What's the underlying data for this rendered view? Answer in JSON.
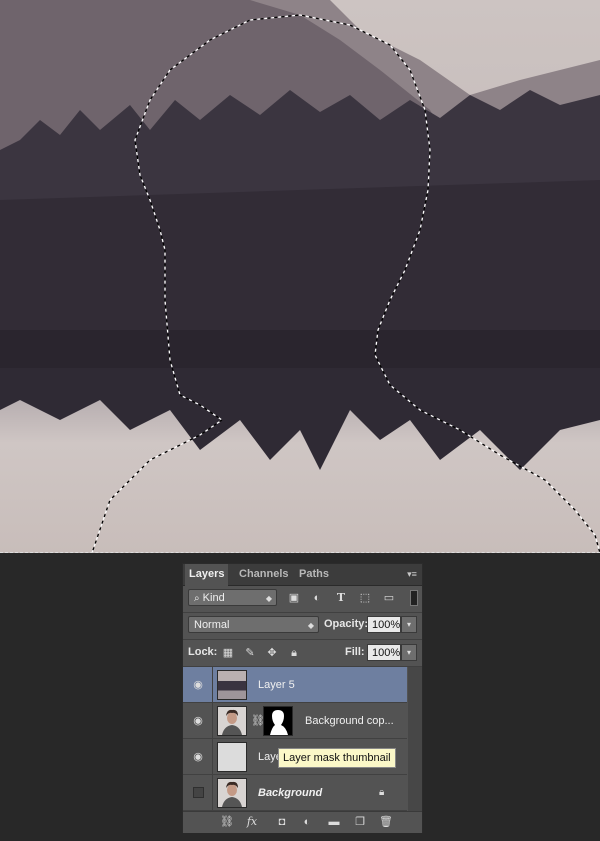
{
  "panel": {
    "tabs": [
      {
        "label": "Layers"
      },
      {
        "label": "Channels"
      },
      {
        "label": "Paths"
      }
    ],
    "filter": {
      "label": "Kind"
    },
    "blend_mode": "Normal",
    "opacity": {
      "label": "Opacity:",
      "value": "100%"
    },
    "lock": {
      "label": "Lock:"
    },
    "fill": {
      "label": "Fill:",
      "value": "100%"
    },
    "layers": [
      {
        "name": "Layer 5",
        "visible": true,
        "selected": true
      },
      {
        "name": "Background cop...",
        "visible": true,
        "selected": false
      },
      {
        "name": "Laye",
        "visible": true,
        "selected": false
      },
      {
        "name": "Background",
        "visible": false,
        "selected": false
      }
    ]
  },
  "tooltip": "Layer mask thumbnail",
  "colors": {
    "selected_layer": "#6e7fa0",
    "panel_bg": "#535353",
    "app_bg": "#282828"
  },
  "icons": [
    "search-icon",
    "image-filter-icon",
    "adjustment-filter-icon",
    "type-filter-icon",
    "shape-filter-icon",
    "smart-object-filter-icon",
    "filter-toggle-icon",
    "lock-pixels-icon",
    "lock-brush-icon",
    "lock-move-icon",
    "lock-all-icon",
    "eye-icon",
    "link-icon",
    "fx-icon",
    "mask-icon",
    "adjustment-icon",
    "folder-icon",
    "new-layer-icon",
    "trash-icon"
  ]
}
